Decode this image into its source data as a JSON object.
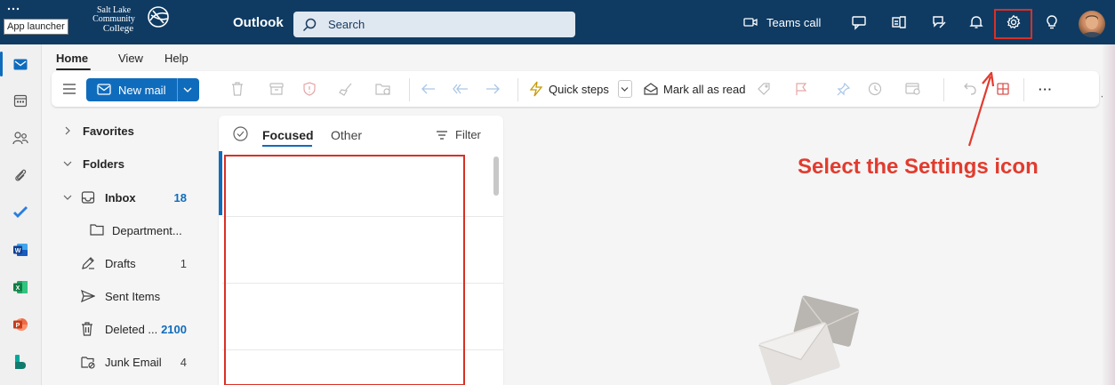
{
  "topbar": {
    "tooltip": "App launcher",
    "logo": {
      "line1": "Salt Lake",
      "line2": "Community",
      "line3": "College"
    },
    "app_name": "Outlook",
    "search_placeholder": "Search",
    "teams_label": "Teams call"
  },
  "rail": {
    "items": [
      "mail-icon",
      "calendar-icon",
      "people-icon",
      "attach-icon",
      "todo-icon",
      "word-icon",
      "excel-icon",
      "powerpoint-icon",
      "bookings-icon"
    ]
  },
  "ribbon": {
    "tabs": [
      "Home",
      "View",
      "Help"
    ],
    "new_mail": "New mail",
    "quick_steps": "Quick steps",
    "mark_all_read": "Mark all as read",
    "more": "···"
  },
  "folders": {
    "favorites": "Favorites",
    "folders": "Folders",
    "items": [
      {
        "label": "Inbox",
        "count": "18"
      },
      {
        "label": "Department...",
        "count": ""
      },
      {
        "label": "Drafts",
        "count": "1"
      },
      {
        "label": "Sent Items",
        "count": ""
      },
      {
        "label": "Deleted ...",
        "count": "2100"
      },
      {
        "label": "Junk Email",
        "count": "4"
      }
    ]
  },
  "message_list": {
    "focused": "Focused",
    "other": "Other",
    "filter": "Filter"
  },
  "annotation": "Select the Settings icon",
  "colors": {
    "topbar": "#0f3b63",
    "accent": "#0f6cbd",
    "annotation": "#e23b2e"
  }
}
